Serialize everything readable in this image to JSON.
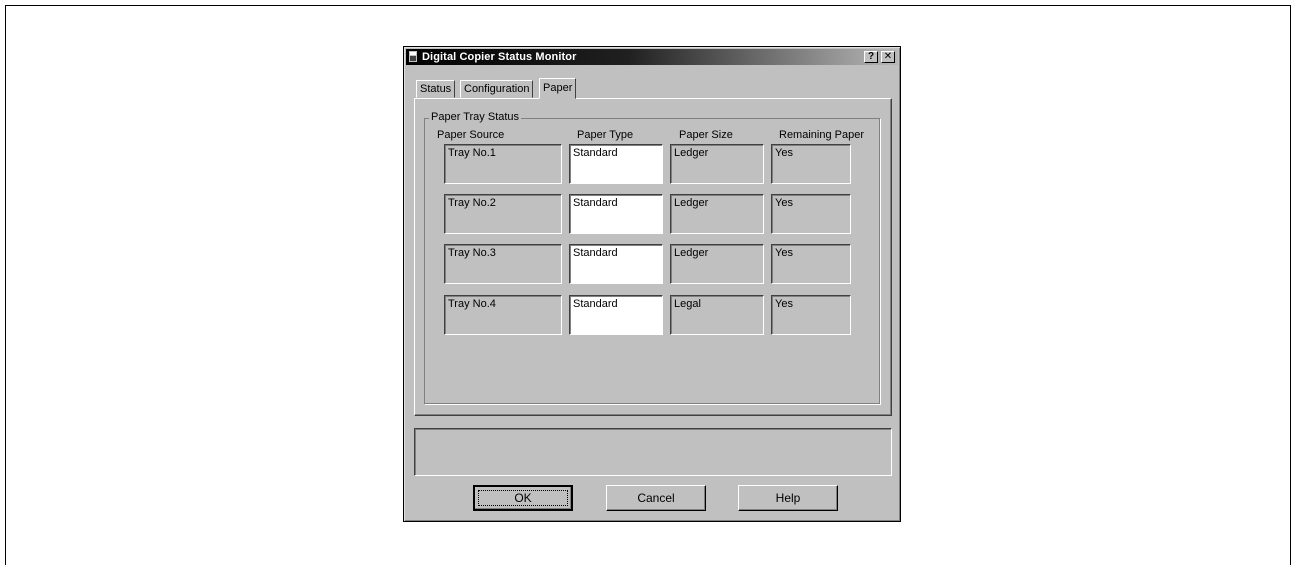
{
  "window": {
    "title": "Digital Copier Status Monitor",
    "help_glyph": "?",
    "close_glyph": "✕"
  },
  "tabs": [
    {
      "label": "Status",
      "active": false
    },
    {
      "label": "Configuration",
      "active": false
    },
    {
      "label": "Paper",
      "active": true
    }
  ],
  "paper": {
    "group_label": "Paper Tray Status",
    "columns": [
      "Paper Source",
      "Paper Type",
      "Paper Size",
      "Remaining Paper"
    ],
    "rows": [
      {
        "source": "Tray No.1",
        "type": "Standard",
        "size": "Ledger",
        "remaining": "Yes"
      },
      {
        "source": "Tray No.2",
        "type": "Standard",
        "size": "Ledger",
        "remaining": "Yes"
      },
      {
        "source": "Tray No.3",
        "type": "Standard",
        "size": "Ledger",
        "remaining": "Yes"
      },
      {
        "source": "Tray No.4",
        "type": "Standard",
        "size": "Legal",
        "remaining": "Yes"
      }
    ]
  },
  "status_message": "",
  "buttons": {
    "ok": "OK",
    "cancel": "Cancel",
    "help": "Help"
  },
  "colors": {
    "dialog_face": "#c0c0c0",
    "title_start": "#000000",
    "title_end": "#b8b8b8"
  }
}
